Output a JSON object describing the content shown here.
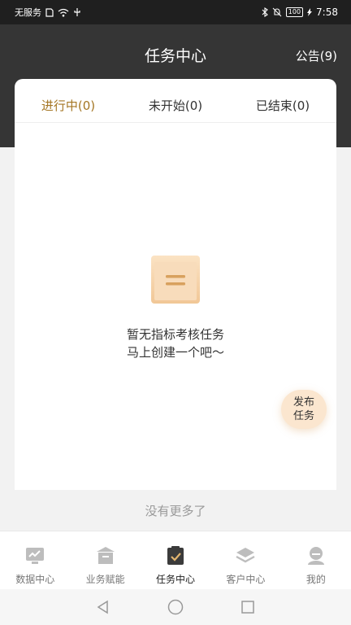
{
  "status_bar": {
    "carrier": "无服务",
    "battery": "100",
    "time": "7:58"
  },
  "header": {
    "title": "任务中心",
    "notice_label": "公告(9)"
  },
  "tabs": [
    {
      "label": "进行中(0)",
      "active": true
    },
    {
      "label": "未开始(0)",
      "active": false
    },
    {
      "label": "已结束(0)",
      "active": false
    }
  ],
  "empty_state": {
    "icon": "empty-task-icon",
    "line1": "暂无指标考核任务",
    "line2": "马上创建一个吧～"
  },
  "fab": {
    "line1": "发布",
    "line2": "任务"
  },
  "no_more_text": "没有更多了",
  "tabbar": [
    {
      "label": "数据中心",
      "icon": "chart-icon",
      "active": false
    },
    {
      "label": "业务赋能",
      "icon": "box-icon",
      "active": false
    },
    {
      "label": "任务中心",
      "icon": "clipboard-icon",
      "active": true
    },
    {
      "label": "客户中心",
      "icon": "layers-icon",
      "active": false
    },
    {
      "label": "我的",
      "icon": "profile-icon",
      "active": false
    }
  ],
  "colors": {
    "header_bg": "#353535",
    "accent": "#a47624",
    "fab_bg": "#fbe6cf",
    "page_bg": "#f2f2f2"
  }
}
